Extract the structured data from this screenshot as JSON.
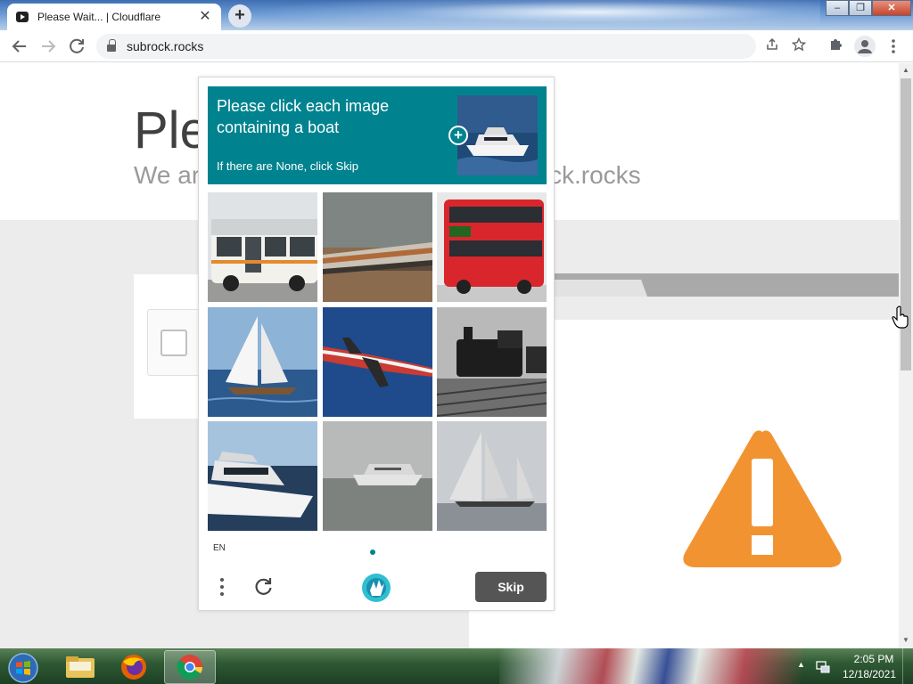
{
  "browser": {
    "tab_title": "Please Wait... | Cloudflare",
    "tab_close": "✕",
    "new_tab": "+",
    "url": "subrock.rocks",
    "window_buttons": [
      "‒",
      "❐",
      "✕"
    ]
  },
  "page": {
    "hero_title": "Ple",
    "hero_sub_left": "We ar",
    "hero_sub_right": "ck.rocks"
  },
  "captcha": {
    "prompt_line": "Please click each image containing a boat",
    "hint": "If there are None, click Skip",
    "plus": "+",
    "images": [
      {
        "name": "bus",
        "label": "city bus"
      },
      {
        "name": "train",
        "label": "freight train"
      },
      {
        "name": "double-decker-bus",
        "label": "red double-decker bus"
      },
      {
        "name": "sailboat",
        "label": "sailboat"
      },
      {
        "name": "airplane",
        "label": "airplane"
      },
      {
        "name": "steam-train",
        "label": "steam locomotive"
      },
      {
        "name": "motor-yacht",
        "label": "motor yacht"
      },
      {
        "name": "yacht-fog",
        "label": "yacht in fog"
      },
      {
        "name": "sailing-ship",
        "label": "sailing ship"
      }
    ],
    "language": "EN",
    "menu": "⋮",
    "refresh": "↻",
    "skip_label": "Skip"
  },
  "taskbar": {
    "time": "2:05 PM",
    "date": "12/18/2021",
    "tray_arrow": "▲"
  },
  "colors": {
    "captcha_accent": "#00838f",
    "warning": "#f29332",
    "skip_button": "#555555"
  }
}
